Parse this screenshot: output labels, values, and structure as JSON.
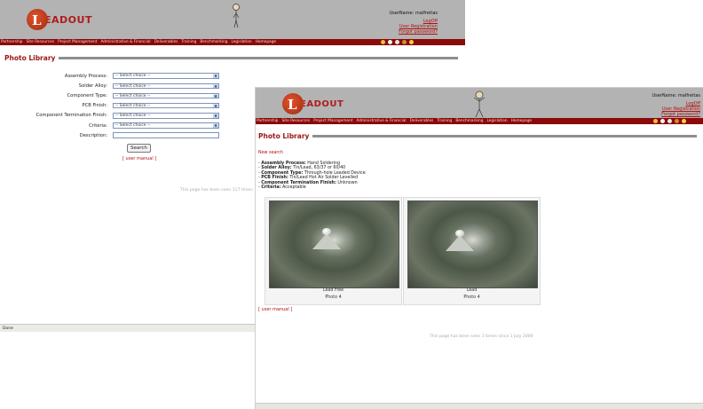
{
  "brand": {
    "logo_letter": "L",
    "logo_text": "EADOUT"
  },
  "user": {
    "username_label": "UserName: malfreitas",
    "links": [
      "LogOff",
      "User Registration",
      "Forgot password?"
    ]
  },
  "nav": {
    "items": [
      "Partnership",
      "Site Resources",
      "Project Management",
      "Administrative & Financial",
      "Deliverables",
      "Training",
      "Benchmarking",
      "Legislation",
      "Homepage"
    ]
  },
  "window1": {
    "page_title": "Photo Library",
    "form": {
      "fields": [
        {
          "label": "Assembly Process:",
          "value": "-- Select choice --"
        },
        {
          "label": "Solder Alloy:",
          "value": "-- Select choice --"
        },
        {
          "label": "Component Type:",
          "value": "-- Select choice --"
        },
        {
          "label": "PCB Finish:",
          "value": "-- Select choice --"
        },
        {
          "label": "Component Termination Finish:",
          "value": "-- Select choice --"
        },
        {
          "label": "Criteria:",
          "value": "-- Select choice --"
        }
      ],
      "description_label": "Description:",
      "description_value": "",
      "search_button": "Search",
      "manual_link": "[ user manual ]"
    },
    "footer_note": "This page has been seen 117 times",
    "status_text": "Done"
  },
  "window2": {
    "page_title": "Photo Library",
    "new_search": "New search",
    "criteria": [
      {
        "key": "Assembly Process:",
        "value": "Hand Soldering"
      },
      {
        "key": "Solder Alloy:",
        "value": "Tin/Lead, 63/37 or 60/40"
      },
      {
        "key": "Component Type:",
        "value": "Through-hole Leaded Device"
      },
      {
        "key": "PCB Finish:",
        "value": "Tin/Lead Hot Air Solder Levelled"
      },
      {
        "key": "Component Termination Finish:",
        "value": "Unknown"
      },
      {
        "key": "Criteria:",
        "value": "Acceptable"
      }
    ],
    "photos": [
      {
        "title": "Lead Free",
        "subtitle": "Photo 4"
      },
      {
        "title": "Lead",
        "subtitle": "Photo 4"
      }
    ],
    "manual_link": "[ user manual ]",
    "footer_note": "This page has been seen 1 times since 1 July 2006"
  },
  "colors": {
    "header_bg": "#b3b3b3",
    "nav_bg": "#8a0a0a",
    "accent": "#9b1717",
    "link": "#b01010"
  }
}
